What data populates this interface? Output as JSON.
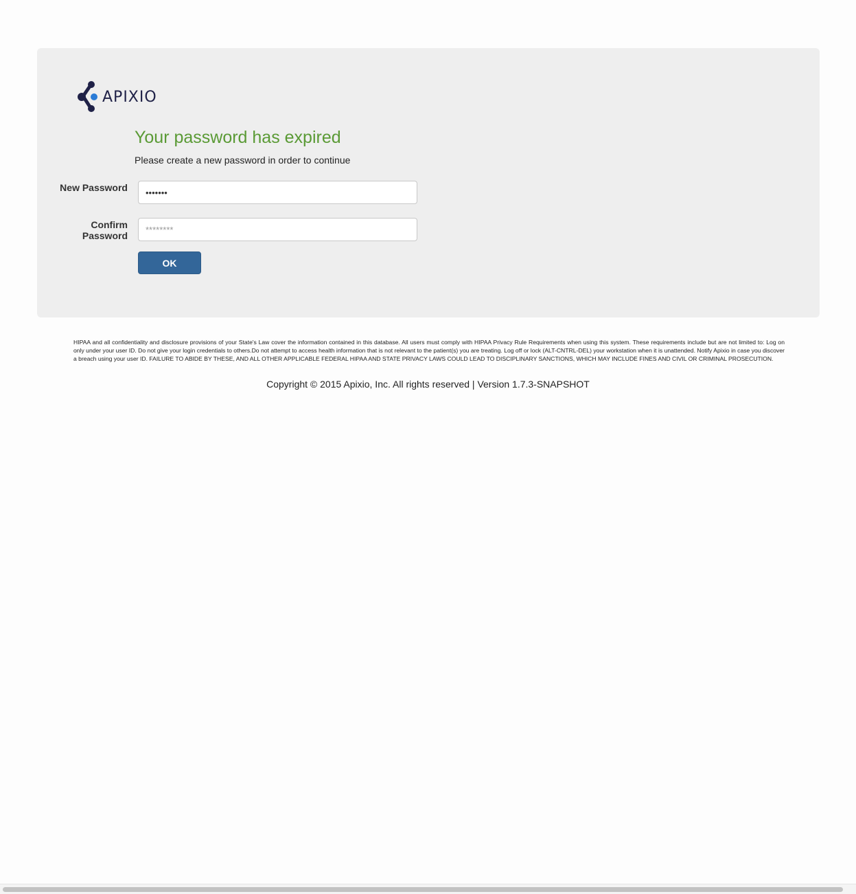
{
  "brand": {
    "name": "APIXIO",
    "primary_color": "#1f2147",
    "accent_color": "#2a7bd6"
  },
  "form": {
    "heading": "Your password has expired",
    "subheading": "Please create a new password in order to continue",
    "new_password_label": "New Password",
    "new_password_value": "•••••••",
    "confirm_password_label": "Confirm Password",
    "confirm_password_placeholder": "********",
    "ok_label": "OK"
  },
  "footer": {
    "disclaimer": "HIPAA and all confidentiality and disclosure provisions of your State's Law cover the information contained in this database. All users must comply with HIPAA Privacy Rule Requirements when using this system. These requirements include but are not limited to: Log on only under your user ID. Do not give your login credentials to others.Do not attempt to access health information that is not relevant to the patient(s) you are treating. Log off or lock (ALT-CNTRL-DEL) your workstation when it is unattended. Notify Apixio in case you discover a breach using your user ID. FAILURE TO ABIDE BY THESE, AND ALL OTHER APPLICABLE FEDERAL HIPAA AND STATE PRIVACY LAWS COULD LEAD TO DISCIPLINARY SANCTIONS, WHICH MAY INCLUDE FINES AND CIVIL OR CRIMINAL PROSECUTION.",
    "copyright": "Copyright © 2015 Apixio, Inc. All rights reserved | Version 1.7.3-SNAPSHOT"
  },
  "heading_color": "#5a9a35",
  "button_color": "#336699"
}
